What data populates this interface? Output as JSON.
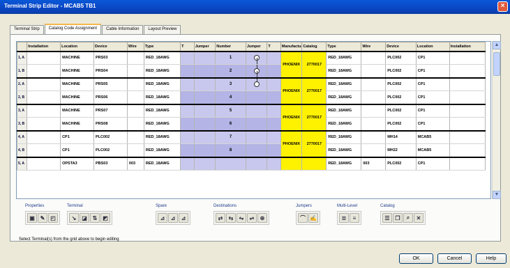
{
  "window": {
    "title": "Terminal Strip Editor - MCAB5 TB1"
  },
  "tabs": [
    "Terminal Strip",
    "Catalog Code Assignment",
    "Cable Information",
    "Layout Preview"
  ],
  "columns": [
    "Installation",
    "Location",
    "Device",
    "Wire",
    "Type",
    "T",
    "Jumper",
    "Number",
    "Jumper",
    "T",
    "Manufacturer",
    "Catalog",
    "Type",
    "Wire",
    "Device",
    "Location",
    "Installation"
  ],
  "rows": [
    {
      "rh": "1, A",
      "l_loc": "MACHINE",
      "l_dev": "PRS03",
      "l_wire": "",
      "l_type": "RED_18AWG",
      "num": "1",
      "manu": "PHOENIX",
      "cat": "2770017",
      "r_type": "RED_18AWG",
      "r_wire": "",
      "r_dev": "PLC002",
      "r_loc": "CP1"
    },
    {
      "rh": "1, B",
      "l_loc": "MACHINE",
      "l_dev": "PRS04",
      "l_wire": "",
      "l_type": "RED_18AWG",
      "num": "2",
      "r_type": "RED_18AWG",
      "r_wire": "",
      "r_dev": "PLC002",
      "r_loc": "CP1"
    },
    {
      "rh": "2, A",
      "l_loc": "MACHINE",
      "l_dev": "PRS05",
      "l_wire": "",
      "l_type": "RED_18AWG",
      "num": "3",
      "manu": "PHOENIX",
      "cat": "2770017",
      "r_type": "RED_18AWG",
      "r_wire": "",
      "r_dev": "PLC002",
      "r_loc": "CP1"
    },
    {
      "rh": "2, B",
      "l_loc": "MACHINE",
      "l_dev": "PRS06",
      "l_wire": "",
      "l_type": "RED_18AWG",
      "num": "4",
      "r_type": "RED_18AWG",
      "r_wire": "",
      "r_dev": "PLC002",
      "r_loc": "CP1"
    },
    {
      "rh": "3, A",
      "l_loc": "MACHINE",
      "l_dev": "PRS07",
      "l_wire": "",
      "l_type": "RED_18AWG",
      "num": "5",
      "manu": "PHOENIX",
      "cat": "2770017",
      "r_type": "RED_18AWG",
      "r_wire": "",
      "r_dev": "PLC002",
      "r_loc": "CP1"
    },
    {
      "rh": "3, B",
      "l_loc": "MACHINE",
      "l_dev": "PRS08",
      "l_wire": "",
      "l_type": "RED_18AWG",
      "num": "6",
      "r_type": "RED_18AWG",
      "r_wire": "",
      "r_dev": "PLC002",
      "r_loc": "CP1"
    },
    {
      "rh": "4, A",
      "l_loc": "CP1",
      "l_dev": "PLC002",
      "l_wire": "",
      "l_type": "RED_18AWG",
      "num": "7",
      "manu": "PHOENIX",
      "cat": "2770017",
      "r_type": "RED_18AWG",
      "r_wire": "",
      "r_dev": "MH14",
      "r_loc": "MCAB5"
    },
    {
      "rh": "4, B",
      "l_loc": "CP1",
      "l_dev": "PLC002",
      "l_wire": "",
      "l_type": "RED_18AWG",
      "num": "8",
      "r_type": "RED_18AWG",
      "r_wire": "",
      "r_dev": "MH22",
      "r_loc": "MCAB5"
    },
    {
      "rh": "5, A",
      "l_loc": "OPSTA3",
      "l_dev": "PBS03",
      "l_wire": "003",
      "l_type": "RED_18AWG",
      "num": "",
      "manu": "",
      "cat": "",
      "r_type": "RED_18AWG",
      "r_wire": "003",
      "r_dev": "PLC002",
      "r_loc": "CP1"
    }
  ],
  "toolbar_groups": [
    {
      "label": "Properties",
      "icons": [
        "properties-icon",
        "edit-properties-icon",
        "pin-properties-icon"
      ]
    },
    {
      "label": "Terminal",
      "icons": [
        "insert-terminal-icon",
        "add-terminal-icon",
        "move-terminal-icon",
        "delete-terminal-icon"
      ]
    },
    {
      "label": "Spare",
      "icons": [
        "spare-insert-icon",
        "spare-add-icon",
        "spare-remove-icon"
      ]
    },
    {
      "label": "Destinations",
      "icons": [
        "flip-destination-icon",
        "swap-destination-icon",
        "reverse-destination-icon",
        "move-destination-icon",
        "jumper-destination-icon"
      ]
    },
    {
      "label": "Jumpers",
      "icons": [
        "jumper-add-icon",
        "jumper-edit-icon"
      ]
    },
    {
      "label": "Multi-Level",
      "icons": [
        "multilevel-add-icon",
        "multilevel-edit-icon"
      ]
    },
    {
      "label": "Catalog",
      "icons": [
        "catalog-assign-icon",
        "catalog-copy-icon",
        "catalog-lookup-icon",
        "catalog-remove-icon"
      ]
    }
  ],
  "status": "Select Terminal(s) from the grid above to begin editing",
  "buttons": {
    "ok": "OK",
    "cancel": "Cancel",
    "help": "Help"
  }
}
